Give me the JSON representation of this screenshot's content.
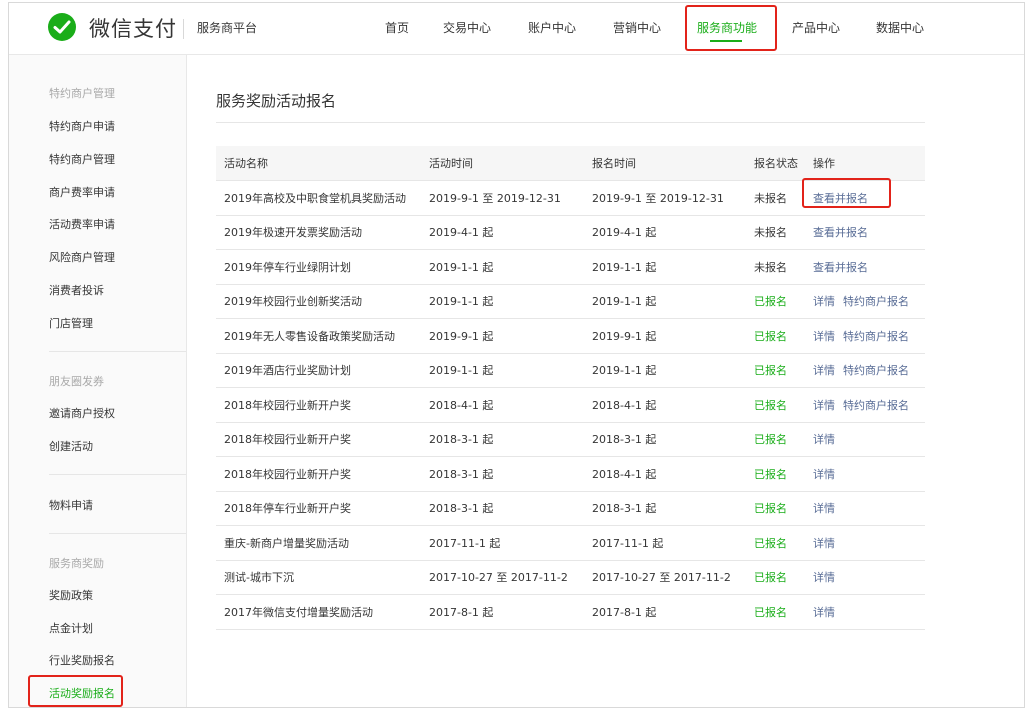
{
  "header": {
    "brand": "微信支付",
    "platform": "服务商平台",
    "nav": [
      "首页",
      "交易中心",
      "账户中心",
      "营销中心",
      "服务商功能",
      "产品中心",
      "数据中心"
    ],
    "active_nav": "服务商功能"
  },
  "sidebar": {
    "group1_title": "特约商户管理",
    "group1_items": [
      "特约商户申请",
      "特约商户管理",
      "商户费率申请",
      "活动费率申请",
      "风险商户管理",
      "消费者投诉",
      "门店管理"
    ],
    "group2_title": "朋友圈发券",
    "group2_items": [
      "邀请商户授权",
      "创建活动"
    ],
    "group3_items": [
      "物料申请"
    ],
    "group4_title": "服务商奖励",
    "group4_items": [
      "奖励政策",
      "点金计划",
      "行业奖励报名",
      "活动奖励报名"
    ],
    "active_item": "活动奖励报名"
  },
  "main": {
    "title": "服务奖励活动报名",
    "columns": [
      "活动名称",
      "活动时间",
      "报名时间",
      "报名状态",
      "操作"
    ],
    "rows": [
      {
        "name": "2019年高校及中职食堂机具奖励活动",
        "activity_time": "2019-9-1 至 2019-12-31",
        "signup_time": "2019-9-1 至 2019-12-31",
        "status": "未报名",
        "ops": [
          "查看并报名"
        ]
      },
      {
        "name": "2019年极速开发票奖励活动",
        "activity_time": "2019-4-1 起",
        "signup_time": "2019-4-1 起",
        "status": "未报名",
        "ops": [
          "查看并报名"
        ]
      },
      {
        "name": "2019年停车行业绿阴计划",
        "activity_time": "2019-1-1 起",
        "signup_time": "2019-1-1 起",
        "status": "未报名",
        "ops": [
          "查看并报名"
        ]
      },
      {
        "name": "2019年校园行业创新奖活动",
        "activity_time": "2019-1-1 起",
        "signup_time": "2019-1-1 起",
        "status": "已报名",
        "ops": [
          "详情",
          "特约商户报名"
        ]
      },
      {
        "name": "2019年无人零售设备政策奖励活动",
        "activity_time": "2019-9-1 起",
        "signup_time": "2019-9-1 起",
        "status": "已报名",
        "ops": [
          "详情",
          "特约商户报名"
        ]
      },
      {
        "name": "2019年酒店行业奖励计划",
        "activity_time": "2019-1-1 起",
        "signup_time": "2019-1-1 起",
        "status": "已报名",
        "ops": [
          "详情",
          "特约商户报名"
        ]
      },
      {
        "name": "2018年校园行业新开户奖",
        "activity_time": "2018-4-1 起",
        "signup_time": "2018-4-1 起",
        "status": "已报名",
        "ops": [
          "详情",
          "特约商户报名"
        ]
      },
      {
        "name": "2018年校园行业新开户奖",
        "activity_time": "2018-3-1 起",
        "signup_time": "2018-3-1 起",
        "status": "已报名",
        "ops": [
          "详情"
        ]
      },
      {
        "name": "2018年校园行业新开户奖",
        "activity_time": "2018-3-1 起",
        "signup_time": "2018-4-1 起",
        "status": "已报名",
        "ops": [
          "详情"
        ]
      },
      {
        "name": "2018年停车行业新开户奖",
        "activity_time": "2018-3-1 起",
        "signup_time": "2018-3-1 起",
        "status": "已报名",
        "ops": [
          "详情"
        ]
      },
      {
        "name": "重庆-新商户增量奖励活动",
        "activity_time": "2017-11-1 起",
        "signup_time": "2017-11-1 起",
        "status": "已报名",
        "ops": [
          "详情"
        ]
      },
      {
        "name": "测试-城市下沉",
        "activity_time": "2017-10-27 至 2017-11-2",
        "signup_time": "2017-10-27 至 2017-11-2",
        "status": "已报名",
        "ops": [
          "详情"
        ]
      },
      {
        "name": "2017年微信支付增量奖励活动",
        "activity_time": "2017-8-1 起",
        "signup_time": "2017-8-1 起",
        "status": "已报名",
        "ops": [
          "详情"
        ]
      }
    ]
  },
  "colors": {
    "accent": "#1aad19",
    "link": "#576b95",
    "highlight": "#e2231a",
    "text": "#353535"
  }
}
